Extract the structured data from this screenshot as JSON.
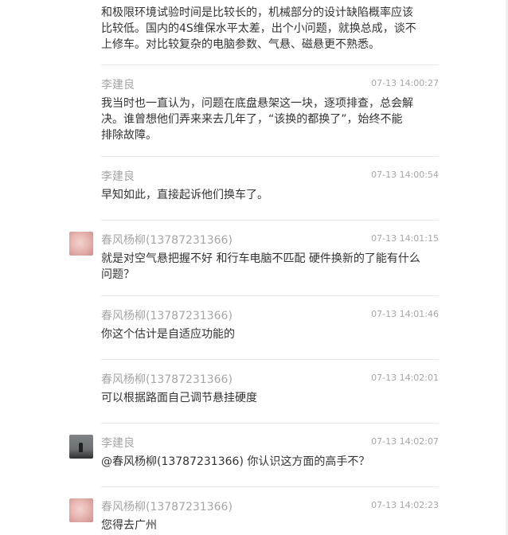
{
  "messages": [
    {
      "user": "",
      "time": "",
      "lines": [
        "和极限环境试验时间是比较长的，机械部分的设计缺陷概率应该",
        "比较低。国内的4S维保水平太差，出个小问题，就换总成，谈不",
        "上修车。对比较复杂的电脑参数、气悬、磁悬更不熟悉。"
      ]
    },
    {
      "user": "李建良",
      "time": "07-13 14:00:27",
      "lines": [
        "我当时也一直认为，问题在底盘悬架这一块，逐项排查，总会解",
        "决。谁曾想他们弄来来去几年了，“该换的都换了”，始终不能",
        "排除故障。"
      ]
    },
    {
      "user": "李建良",
      "time": "07-13 14:00:54",
      "lines": [
        "早知如此，直接起诉他们换车了。"
      ]
    },
    {
      "user": "春风杨柳(13787231366)",
      "time": "07-13 14:01:15",
      "avatar": "pink-avatar",
      "lines": [
        "就是对空气悬把握不好 和行车电脑不匹配 硬件换新的了能有什么",
        "问题？"
      ]
    },
    {
      "user": "春风杨柳(13787231366)",
      "time": "07-13 14:01:46",
      "lines": [
        "你这个估计是自适应功能的"
      ]
    },
    {
      "user": "春风杨柳(13787231366)",
      "time": "07-13 14:02:01",
      "lines": [
        "可以根据路面自己调节悬挂硬度"
      ]
    },
    {
      "user": "李建良",
      "time": "07-13 14:02:07",
      "avatar": "silhouette-avatar",
      "lines": [
        "@春风杨柳(13787231366) 你认识这方面的高手不？"
      ]
    },
    {
      "user": "春风杨柳(13787231366)",
      "time": "07-13 14:02:23",
      "avatar": "pink-avatar",
      "lines": [
        "您得去广州"
      ]
    }
  ]
}
